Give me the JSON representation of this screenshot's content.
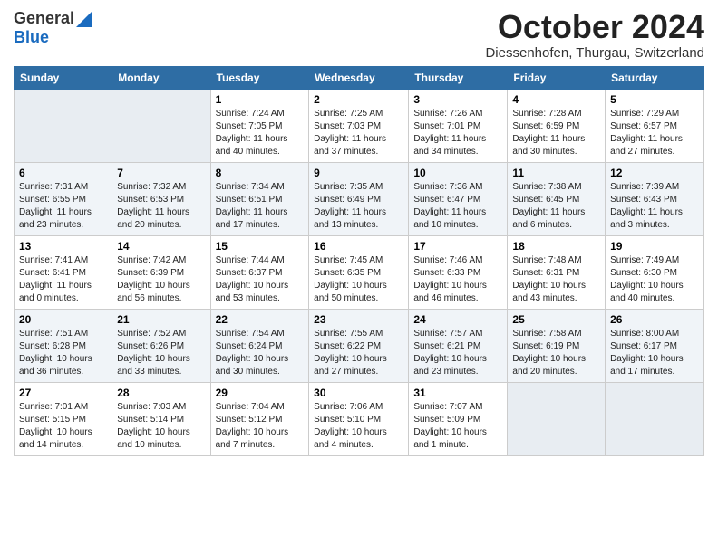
{
  "header": {
    "logo_general": "General",
    "logo_blue": "Blue",
    "month_title": "October 2024",
    "location": "Diessenhofen, Thurgau, Switzerland"
  },
  "days_of_week": [
    "Sunday",
    "Monday",
    "Tuesday",
    "Wednesday",
    "Thursday",
    "Friday",
    "Saturday"
  ],
  "weeks": [
    [
      {
        "day": "",
        "empty": true
      },
      {
        "day": "",
        "empty": true
      },
      {
        "day": "1",
        "sunrise": "Sunrise: 7:24 AM",
        "sunset": "Sunset: 7:05 PM",
        "daylight": "Daylight: 11 hours and 40 minutes."
      },
      {
        "day": "2",
        "sunrise": "Sunrise: 7:25 AM",
        "sunset": "Sunset: 7:03 PM",
        "daylight": "Daylight: 11 hours and 37 minutes."
      },
      {
        "day": "3",
        "sunrise": "Sunrise: 7:26 AM",
        "sunset": "Sunset: 7:01 PM",
        "daylight": "Daylight: 11 hours and 34 minutes."
      },
      {
        "day": "4",
        "sunrise": "Sunrise: 7:28 AM",
        "sunset": "Sunset: 6:59 PM",
        "daylight": "Daylight: 11 hours and 30 minutes."
      },
      {
        "day": "5",
        "sunrise": "Sunrise: 7:29 AM",
        "sunset": "Sunset: 6:57 PM",
        "daylight": "Daylight: 11 hours and 27 minutes."
      }
    ],
    [
      {
        "day": "6",
        "sunrise": "Sunrise: 7:31 AM",
        "sunset": "Sunset: 6:55 PM",
        "daylight": "Daylight: 11 hours and 23 minutes."
      },
      {
        "day": "7",
        "sunrise": "Sunrise: 7:32 AM",
        "sunset": "Sunset: 6:53 PM",
        "daylight": "Daylight: 11 hours and 20 minutes."
      },
      {
        "day": "8",
        "sunrise": "Sunrise: 7:34 AM",
        "sunset": "Sunset: 6:51 PM",
        "daylight": "Daylight: 11 hours and 17 minutes."
      },
      {
        "day": "9",
        "sunrise": "Sunrise: 7:35 AM",
        "sunset": "Sunset: 6:49 PM",
        "daylight": "Daylight: 11 hours and 13 minutes."
      },
      {
        "day": "10",
        "sunrise": "Sunrise: 7:36 AM",
        "sunset": "Sunset: 6:47 PM",
        "daylight": "Daylight: 11 hours and 10 minutes."
      },
      {
        "day": "11",
        "sunrise": "Sunrise: 7:38 AM",
        "sunset": "Sunset: 6:45 PM",
        "daylight": "Daylight: 11 hours and 6 minutes."
      },
      {
        "day": "12",
        "sunrise": "Sunrise: 7:39 AM",
        "sunset": "Sunset: 6:43 PM",
        "daylight": "Daylight: 11 hours and 3 minutes."
      }
    ],
    [
      {
        "day": "13",
        "sunrise": "Sunrise: 7:41 AM",
        "sunset": "Sunset: 6:41 PM",
        "daylight": "Daylight: 11 hours and 0 minutes."
      },
      {
        "day": "14",
        "sunrise": "Sunrise: 7:42 AM",
        "sunset": "Sunset: 6:39 PM",
        "daylight": "Daylight: 10 hours and 56 minutes."
      },
      {
        "day": "15",
        "sunrise": "Sunrise: 7:44 AM",
        "sunset": "Sunset: 6:37 PM",
        "daylight": "Daylight: 10 hours and 53 minutes."
      },
      {
        "day": "16",
        "sunrise": "Sunrise: 7:45 AM",
        "sunset": "Sunset: 6:35 PM",
        "daylight": "Daylight: 10 hours and 50 minutes."
      },
      {
        "day": "17",
        "sunrise": "Sunrise: 7:46 AM",
        "sunset": "Sunset: 6:33 PM",
        "daylight": "Daylight: 10 hours and 46 minutes."
      },
      {
        "day": "18",
        "sunrise": "Sunrise: 7:48 AM",
        "sunset": "Sunset: 6:31 PM",
        "daylight": "Daylight: 10 hours and 43 minutes."
      },
      {
        "day": "19",
        "sunrise": "Sunrise: 7:49 AM",
        "sunset": "Sunset: 6:30 PM",
        "daylight": "Daylight: 10 hours and 40 minutes."
      }
    ],
    [
      {
        "day": "20",
        "sunrise": "Sunrise: 7:51 AM",
        "sunset": "Sunset: 6:28 PM",
        "daylight": "Daylight: 10 hours and 36 minutes."
      },
      {
        "day": "21",
        "sunrise": "Sunrise: 7:52 AM",
        "sunset": "Sunset: 6:26 PM",
        "daylight": "Daylight: 10 hours and 33 minutes."
      },
      {
        "day": "22",
        "sunrise": "Sunrise: 7:54 AM",
        "sunset": "Sunset: 6:24 PM",
        "daylight": "Daylight: 10 hours and 30 minutes."
      },
      {
        "day": "23",
        "sunrise": "Sunrise: 7:55 AM",
        "sunset": "Sunset: 6:22 PM",
        "daylight": "Daylight: 10 hours and 27 minutes."
      },
      {
        "day": "24",
        "sunrise": "Sunrise: 7:57 AM",
        "sunset": "Sunset: 6:21 PM",
        "daylight": "Daylight: 10 hours and 23 minutes."
      },
      {
        "day": "25",
        "sunrise": "Sunrise: 7:58 AM",
        "sunset": "Sunset: 6:19 PM",
        "daylight": "Daylight: 10 hours and 20 minutes."
      },
      {
        "day": "26",
        "sunrise": "Sunrise: 8:00 AM",
        "sunset": "Sunset: 6:17 PM",
        "daylight": "Daylight: 10 hours and 17 minutes."
      }
    ],
    [
      {
        "day": "27",
        "sunrise": "Sunrise: 7:01 AM",
        "sunset": "Sunset: 5:15 PM",
        "daylight": "Daylight: 10 hours and 14 minutes."
      },
      {
        "day": "28",
        "sunrise": "Sunrise: 7:03 AM",
        "sunset": "Sunset: 5:14 PM",
        "daylight": "Daylight: 10 hours and 10 minutes."
      },
      {
        "day": "29",
        "sunrise": "Sunrise: 7:04 AM",
        "sunset": "Sunset: 5:12 PM",
        "daylight": "Daylight: 10 hours and 7 minutes."
      },
      {
        "day": "30",
        "sunrise": "Sunrise: 7:06 AM",
        "sunset": "Sunset: 5:10 PM",
        "daylight": "Daylight: 10 hours and 4 minutes."
      },
      {
        "day": "31",
        "sunrise": "Sunrise: 7:07 AM",
        "sunset": "Sunset: 5:09 PM",
        "daylight": "Daylight: 10 hours and 1 minute."
      },
      {
        "day": "",
        "empty": true
      },
      {
        "day": "",
        "empty": true
      }
    ]
  ]
}
